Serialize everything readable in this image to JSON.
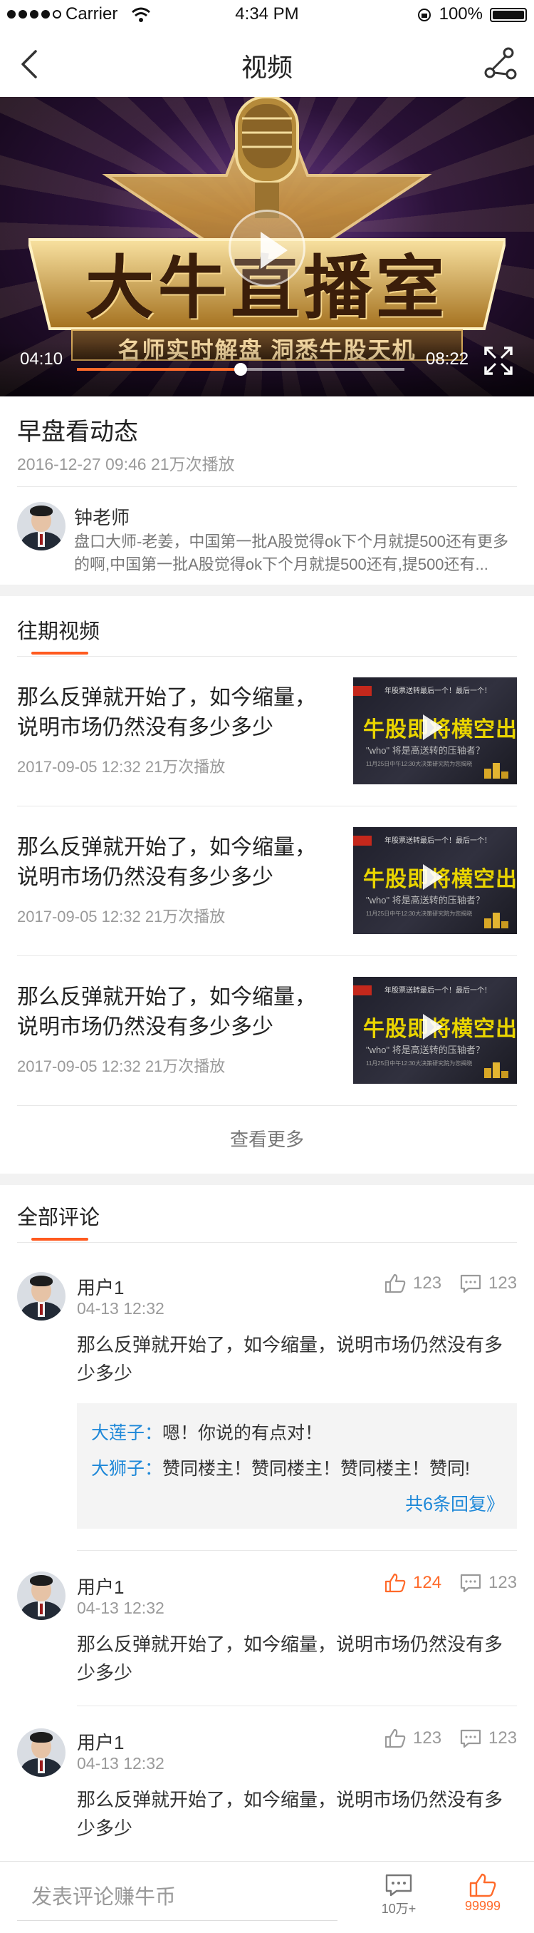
{
  "status_bar": {
    "carrier": "Carrier",
    "time": "4:34 PM",
    "battery": "100%"
  },
  "nav": {
    "title": "视频"
  },
  "player": {
    "poster_title": "大牛直播室",
    "poster_subtitle": "名师实时解盘 洞悉牛股天机",
    "current_time": "04:10",
    "duration": "08:22",
    "progress": 0.5
  },
  "video": {
    "title": "早盘看动态",
    "meta": "2016-12-27  09:46  21万次播放"
  },
  "teacher": {
    "name": "钟老师",
    "desc": "盘口大师-老姜，中国第一批A股觉得ok下个月就提500还有更多的啊,中国第一批A股觉得ok下个月就提500还有,提500还有..."
  },
  "past_videos": {
    "title": "往期视频",
    "items": [
      {
        "title": "那么反弹就开始了，如今缩量，说明市场仍然没有多少多少",
        "meta": "2017-09-05  12:32  21万次播放"
      },
      {
        "title": "那么反弹就开始了，如今缩量，说明市场仍然没有多少多少",
        "meta": "2017-09-05  12:32  21万次播放"
      },
      {
        "title": "那么反弹就开始了，如今缩量，说明市场仍然没有多少多少",
        "meta": "2017-09-05  12:32  21万次播放"
      }
    ],
    "thumb": {
      "top": "年股票送转最后一个！最后一个！",
      "main": "牛股即将横空出世！",
      "sub": "\"who\" 将是高送转的压轴者？",
      "small": "11月25日中午12:30大决策研究院为您揭晓"
    },
    "more": "查看更多"
  },
  "comments": {
    "title": "全部评论",
    "items": [
      {
        "user": "用户1",
        "time": "04-13  12:32",
        "likes": "123",
        "replies": "123",
        "liked": false,
        "text": "那么反弹就开始了，如今缩量，说明市场仍然没有多少多少",
        "sub_replies": [
          {
            "who": "大莲子：",
            "text": "嗯！你说的有点对！"
          },
          {
            "who": "大狮子：",
            "text": "赞同楼主！赞同楼主！赞同楼主！赞同!"
          }
        ],
        "more_replies": "共6条回复》"
      },
      {
        "user": "用户1",
        "time": "04-13  12:32",
        "likes": "124",
        "replies": "123",
        "liked": true,
        "text": "那么反弹就开始了，如今缩量，说明市场仍然没有多少多少"
      },
      {
        "user": "用户1",
        "time": "04-13  12:32",
        "likes": "123",
        "replies": "123",
        "liked": false,
        "text": "那么反弹就开始了，如今缩量，说明市场仍然没有多少多少"
      }
    ]
  },
  "bottom_bar": {
    "placeholder": "发表评论赚牛币",
    "comment_count": "10万+",
    "like_count": "99999"
  },
  "colors": {
    "accent": "#ff6a2a",
    "link": "#1e88d8"
  }
}
